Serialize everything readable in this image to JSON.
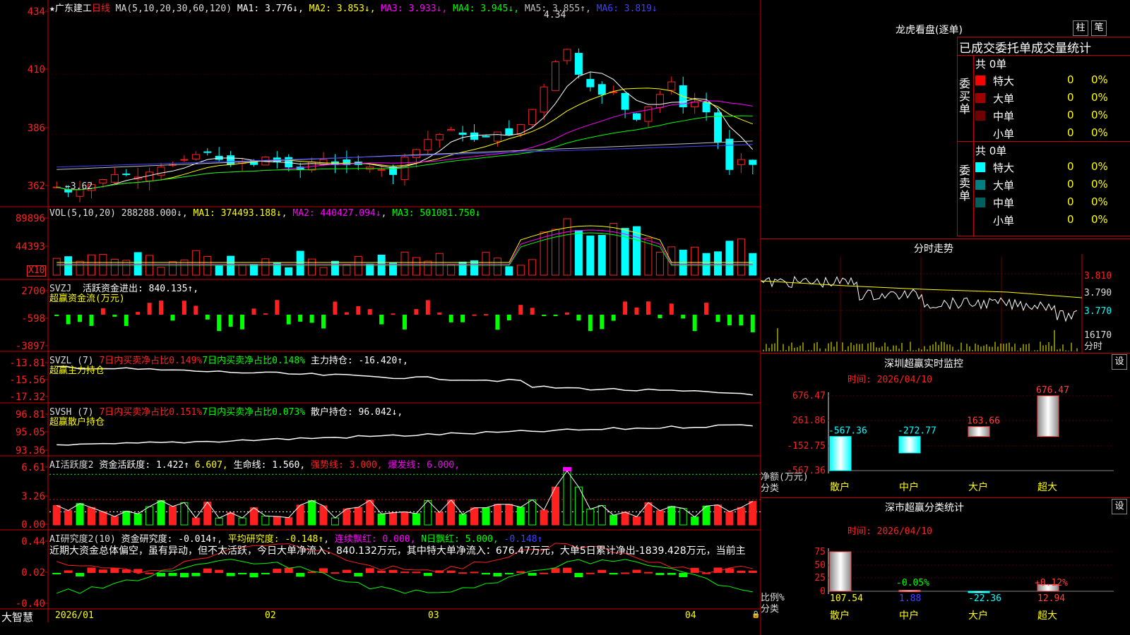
{
  "colors": {
    "up": "#ff2020",
    "down": "#00ffff",
    "grid": "#c80000",
    "ma1": "#ffffff",
    "ma2": "#ffff00",
    "ma3": "#ff00ff",
    "ma4": "#00ff00",
    "ma5": "#c0c0c0",
    "ma6": "#4040ff",
    "green": "#00ff00"
  },
  "price_panel": {
    "title": "★广东建工",
    "period": "日线",
    "ma_params": "MA(5,10,20,30,60,120)",
    "ma_items": [
      {
        "label": "MA1: 3.776↓",
        "color": "#ffffff"
      },
      {
        "label": "MA2: 3.853↓",
        "color": "#ffff00"
      },
      {
        "label": "MA3: 3.933↓",
        "color": "#ff00ff"
      },
      {
        "label": "MA4: 3.945↓",
        "color": "#00ff00"
      },
      {
        "label": "MA5: 3.855↑",
        "color": "#c0c0c0"
      },
      {
        "label": "MA6: 3.819↓",
        "color": "#4040ff"
      }
    ],
    "y_ticks": [
      "434",
      "410",
      "386",
      "362"
    ],
    "high_label": "4.34",
    "low_label": "←3.62"
  },
  "vol_panel": {
    "title": "VOL(5,10,20)",
    "value": "288288.000↓",
    "ma1": "MA1: 374493.188↓",
    "ma2": "MA2: 440427.094↓",
    "ma3": "MA3: 501081.750↓",
    "y_ticks": [
      "89896",
      "44393"
    ],
    "unit": "X10"
  },
  "svzj_panel": {
    "title": "SVZJ",
    "label": "活跃资金进出: 840.135↑,",
    "sub": "超赢资金流(万元)",
    "y_ticks": [
      "2700",
      "-598",
      "-3897"
    ]
  },
  "svzl_panel": {
    "title": "SVZL (7)",
    "a": "7日内买卖净占比0.149%",
    "b": "7日内买卖净占比0.148%",
    "c": "主力持仓: -16.420↑,",
    "sub": "超赢主力持仓",
    "y_ticks": [
      "-13.81",
      "-15.56",
      "-17.32"
    ]
  },
  "svsh_panel": {
    "title": "SVSH (7)",
    "a": "7日内买卖净占比0.151%",
    "b": "7日内买卖净占比0.073%",
    "c": "散户持仓: 96.042↓,",
    "sub": "超赢散户持仓",
    "y_ticks": [
      "96.81",
      "95.05",
      "93.36"
    ]
  },
  "ai1_panel": {
    "title": "AI活跃度2",
    "a": "资金活跃度: 1.422↑",
    "b": "6.607,",
    "c": "生命线: 1.560,",
    "d": "强势线: 3.000,",
    "e": "爆发线: 6.000,",
    "y_ticks": [
      "6.61",
      "3.26",
      "0.00"
    ]
  },
  "ai2_panel": {
    "title": "AI研究度2(10)",
    "a": "资金研究度: -0.014↑",
    "b": "平均研究度: -0.148↑",
    "c": "连续飘红: 0.000,",
    "d": "N日飘红: 5.000,",
    "e": "-0.148↑",
    "desc": "近期大资金总体偏空，虽有异动，但不太活跃，今日大单净流入：840.132万元，其中特大单净流入：676.47万元，大单5日累计净出-1839.428万元，当前主",
    "y_ticks": [
      "0.44",
      "0.02",
      "-0.40"
    ]
  },
  "x_axis": {
    "start_label": "大智慧",
    "dates": [
      "2026/01",
      "02",
      "03",
      "04"
    ]
  },
  "lhb": {
    "title": "龙虎看盘(逐单)",
    "btn_zhu": "柱",
    "btn_bi": "笔",
    "header": "已成交委托单成交量统计",
    "buy": {
      "side": "委买单",
      "total": "共 0单",
      "rows": [
        {
          "name": "特大",
          "v": "0",
          "p": "0%",
          "c": "#ff0000"
        },
        {
          "name": "大单",
          "v": "0",
          "p": "0%",
          "c": "#a00000"
        },
        {
          "name": "中单",
          "v": "0",
          "p": "0%",
          "c": "#700000"
        },
        {
          "name": "小单",
          "v": "0",
          "p": "0%",
          "c": "#000"
        }
      ]
    },
    "sell": {
      "side": "委卖单",
      "total": "共 0单",
      "rows": [
        {
          "name": "特大",
          "v": "0",
          "p": "0%",
          "c": "#00ffff"
        },
        {
          "name": "大单",
          "v": "0",
          "p": "0%",
          "c": "#008080"
        },
        {
          "name": "中单",
          "v": "0",
          "p": "0%",
          "c": "#006060"
        },
        {
          "name": "小单",
          "v": "0",
          "p": "0%",
          "c": "#000"
        }
      ]
    }
  },
  "fenshi": {
    "title": "分时走势",
    "y_ticks": [
      "3.810",
      "3.790",
      "3.770"
    ],
    "vol_tick": "16170",
    "unit": "分时"
  },
  "sz_monitor": {
    "title": "深圳超赢实时监控",
    "btn": "设",
    "time": "时间: 2026/04/10",
    "y_ticks": [
      "676.47",
      "261.86",
      "-152.75",
      "-567.36"
    ],
    "y_label": "净额(万元)",
    "x_label": "分类",
    "chart_data": {
      "type": "bar",
      "categories": [
        "散户",
        "中户",
        "大户",
        "超大"
      ],
      "values": [
        -567.36,
        -272.77,
        163.66,
        676.47
      ],
      "ylim": [
        -567.36,
        676.47
      ]
    }
  },
  "sz_class": {
    "title": "深市超赢分类统计",
    "btn": "设",
    "time": "时间: 2026/04/10",
    "y_ticks": [
      "75",
      "50",
      "25",
      "0"
    ],
    "y_label": "比例%",
    "x_label": "分类",
    "chart_data": {
      "type": "bar",
      "categories": [
        "散户",
        "中户",
        "大户",
        "超大"
      ],
      "values": [
        107.54,
        1.88,
        -22.36,
        12.94
      ],
      "bar_labels": [
        "",
        "-0.05%",
        "",
        "+0.12%"
      ]
    }
  }
}
